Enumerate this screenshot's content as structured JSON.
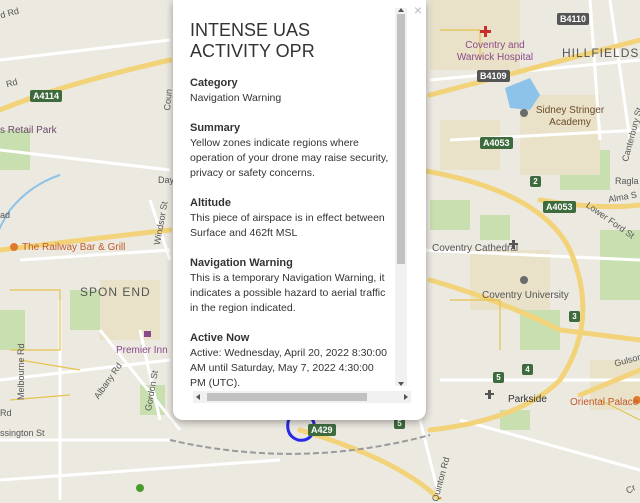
{
  "popup": {
    "title": "INTENSE UAS ACTIVITY OPR",
    "close_icon": "×",
    "sections": [
      {
        "heading": "Category",
        "body": "Navigation Warning"
      },
      {
        "heading": "Summary",
        "body": "Yellow zones indicate regions where operation of your drone may raise security, privacy or safety concerns."
      },
      {
        "heading": "Altitude",
        "body": "This piece of airspace is in effect between Surface and 462ft MSL"
      },
      {
        "heading": "Navigation Warning",
        "body": "This is a temporary Navigation Warning, it indicates a possible hazard to aerial traffic in the region indicated."
      },
      {
        "heading": "Active Now",
        "body": "Active: Wednesday, April 20, 2022 8:30:00 AM until Saturday, May 7, 2022 4:30:00 PM (UTC)."
      }
    ]
  },
  "map": {
    "labels": {
      "coventry_hospital": "Coventry and Warwick Hospital",
      "hillfields": "HILLFIELDS",
      "retail_park": "s Retail Park",
      "railway_bar": "The Railway Bar & Grill",
      "spon_end": "SPON END",
      "premier_inn": "Premier Inn",
      "sidney_stringer": "Sidney Stringer Academy",
      "coventry_cathedral": "Coventry Cathedral",
      "coventry_university": "Coventry University",
      "oriental_palace": "Oriental Palace",
      "parkside": "Parkside",
      "windsor_st": "Windsor St",
      "albany_rd": "Albany Rd",
      "gordon_st": "Gordon St",
      "melbourne_rd": "Melbourne Rd",
      "canterbury_st": "Canterbury St",
      "ragla": "Ragla",
      "alma_st": "Alma S",
      "lower_ford_st": "Lower Ford St",
      "gulson": "Gulson",
      "quinton_rd": "Quinton Rd",
      "essington_st": "ssington St",
      "day_frag": "Day",
      "coun_frag": "Coun",
      "rd_frag": "Rd",
      "d_rd": "d Rd",
      "ad": "ad",
      "rd_2": "Rd",
      "ph_frag": "Ph",
      "cr_frag": "Cr"
    },
    "shields": {
      "b4110": "B4110",
      "b4109": "B4109",
      "a4114": "A4114",
      "a4053a": "A4053",
      "a4053b": "A4053",
      "a429": "A429",
      "j2": "2",
      "j3": "3",
      "j4": "4",
      "j5": "5",
      "j5b": "5"
    },
    "colors": {
      "background": "#ece9e1",
      "major_road": "#f2d37a",
      "park": "#c8dfb0",
      "water": "#8dc3e8",
      "aoi_circle": "#2a2ae6",
      "poi_red": "#c9302c",
      "poi_purple": "#8a4a8a"
    }
  }
}
